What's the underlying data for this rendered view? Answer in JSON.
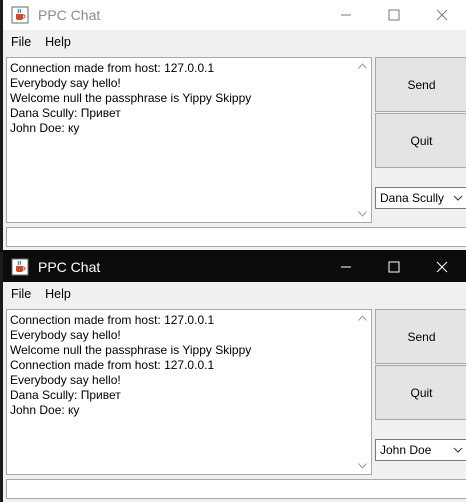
{
  "windows": [
    {
      "title": "PPC Chat",
      "menu": [
        "File",
        "Help"
      ],
      "chat_lines": [
        "Connection made from host: 127.0.0.1",
        "Everybody say hello!",
        "Welcome null the passphrase is Yippy Skippy",
        "Dana Scully: Привет",
        "John Doe: ку"
      ],
      "send_label": "Send",
      "quit_label": "Quit",
      "user_select": "Dana Scully",
      "message_input": ""
    },
    {
      "title": "PPC Chat",
      "menu": [
        "File",
        "Help"
      ],
      "chat_lines": [
        "Connection made from host: 127.0.0.1",
        "Everybody say hello!",
        "Welcome null the passphrase is Yippy Skippy",
        "Connection made from host: 127.0.0.1",
        "Everybody say hello!",
        "Dana Scully: Привет",
        "John Doe: ку"
      ],
      "send_label": "Send",
      "quit_label": "Quit",
      "user_select": "John Doe",
      "message_input": ""
    }
  ],
  "colors": {
    "inactive_titlebar": "#ffffff",
    "active_titlebar": "#0c0c0c",
    "window_bg": "#f0f0f0",
    "button_bg": "#e4e4e4",
    "accent_strip": "#c64061"
  },
  "icons": [
    "java-cup-icon",
    "minimize-icon",
    "maximize-icon",
    "close-icon",
    "scroll-up-icon",
    "scroll-down-icon",
    "chevron-down-icon"
  ]
}
